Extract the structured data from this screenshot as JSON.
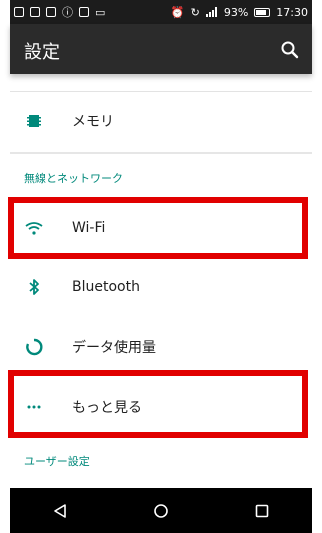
{
  "status_bar": {
    "battery_percent": "93%",
    "time": "17:30"
  },
  "header": {
    "title": "設定"
  },
  "rows": {
    "memory": "メモリ",
    "wifi": "Wi-Fi",
    "bluetooth": "Bluetooth",
    "data_usage": "データ使用量",
    "more": "もっと見る"
  },
  "sections": {
    "wireless": "無線とネットワーク",
    "user": "ユーザー設定"
  },
  "colors": {
    "accent": "#00897b",
    "highlight": "#e10000",
    "action_bar": "#2b2b2b"
  }
}
